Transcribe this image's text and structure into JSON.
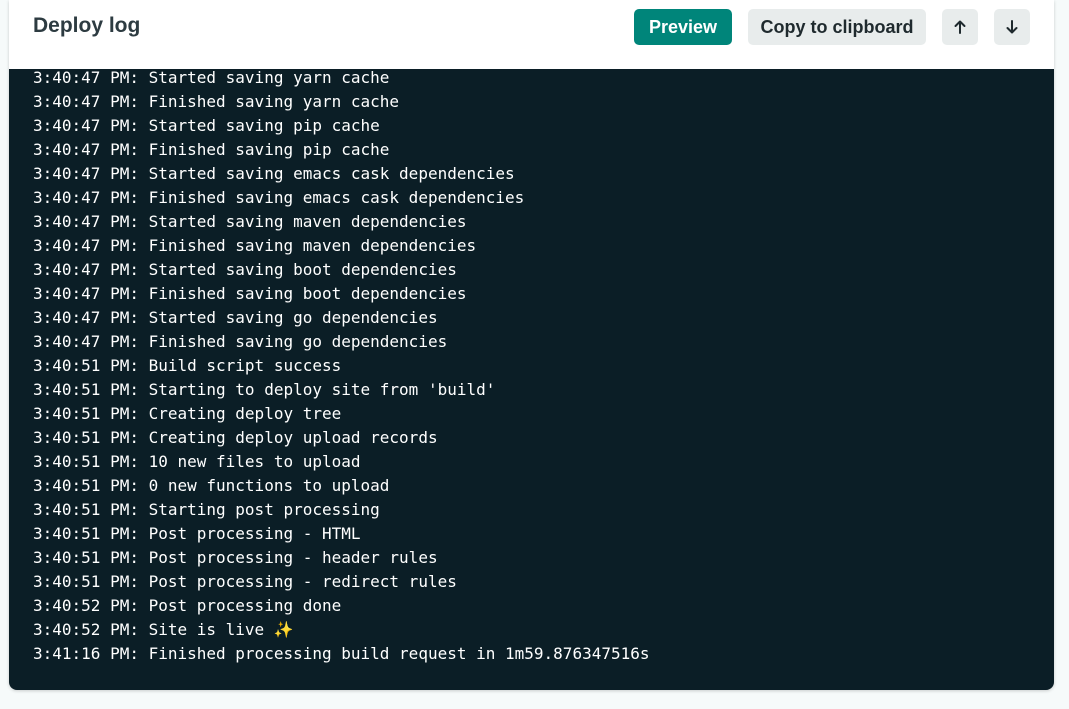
{
  "header": {
    "title": "Deploy log",
    "preview_label": "Preview",
    "copy_label": "Copy to clipboard",
    "scroll_up_icon": "arrow-up-icon",
    "scroll_down_icon": "arrow-down-icon"
  },
  "colors": {
    "accent": "#00857a",
    "log_background": "#0b1e26",
    "page_background": "#f6fafa"
  },
  "log_lines": [
    "3:40:47 PM: Started saving yarn cache",
    "3:40:47 PM: Finished saving yarn cache",
    "3:40:47 PM: Started saving pip cache",
    "3:40:47 PM: Finished saving pip cache",
    "3:40:47 PM: Started saving emacs cask dependencies",
    "3:40:47 PM: Finished saving emacs cask dependencies",
    "3:40:47 PM: Started saving maven dependencies",
    "3:40:47 PM: Finished saving maven dependencies",
    "3:40:47 PM: Started saving boot dependencies",
    "3:40:47 PM: Finished saving boot dependencies",
    "3:40:47 PM: Started saving go dependencies",
    "3:40:47 PM: Finished saving go dependencies",
    "3:40:51 PM: Build script success",
    "3:40:51 PM: Starting to deploy site from 'build'",
    "3:40:51 PM: Creating deploy tree",
    "3:40:51 PM: Creating deploy upload records",
    "3:40:51 PM: 10 new files to upload",
    "3:40:51 PM: 0 new functions to upload",
    "3:40:51 PM: Starting post processing",
    "3:40:51 PM: Post processing - HTML",
    "3:40:51 PM: Post processing - header rules",
    "3:40:51 PM: Post processing - redirect rules",
    "3:40:52 PM: Post processing done",
    "3:40:52 PM: Site is live ✨",
    "3:41:16 PM: Finished processing build request in 1m59.876347516s"
  ]
}
